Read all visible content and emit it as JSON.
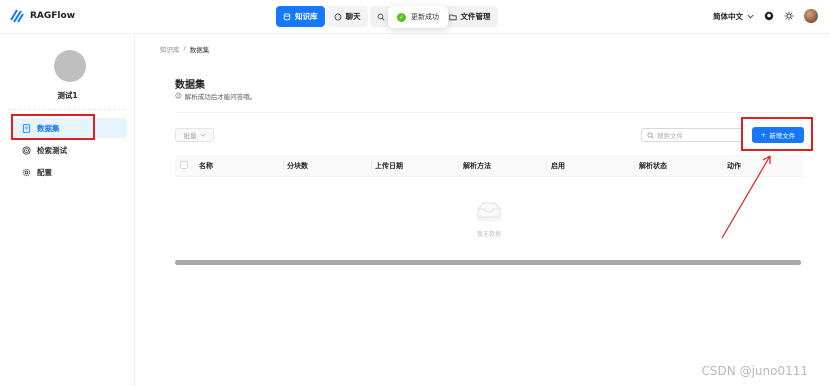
{
  "app": {
    "name": "RAGFlow"
  },
  "nav": {
    "items": [
      {
        "label": "知识库",
        "icon": "database-icon",
        "active": true
      },
      {
        "label": "聊天",
        "icon": "chat-icon",
        "active": false
      },
      {
        "label": "搜索",
        "icon": "search-icon",
        "active": false
      },
      {
        "label": "文件管理",
        "icon": "folder-icon",
        "active": false
      }
    ]
  },
  "toast": {
    "text": "更新成功",
    "icon": "check-circle-icon",
    "color": "#52c41a"
  },
  "header_right": {
    "language": "简体中文"
  },
  "sidebar": {
    "kb_name": "测试1",
    "items": [
      {
        "label": "数据集",
        "icon": "document-icon",
        "active": true
      },
      {
        "label": "检索测试",
        "icon": "target-icon",
        "active": false
      },
      {
        "label": "配置",
        "icon": "gear-icon",
        "active": false
      }
    ]
  },
  "breadcrumb": {
    "root": "知识库",
    "sep": "/",
    "current": "数据集"
  },
  "main": {
    "title": "数据集",
    "subtitle_emoji": "😉",
    "subtitle": "解析成功后才能问答哦。",
    "batch_label": "批量",
    "search_placeholder": "搜索文件",
    "new_button_label": "新增文件",
    "columns": [
      "名称",
      "分块数",
      "上传日期",
      "解析方法",
      "启用",
      "解析状态",
      "动作"
    ],
    "empty_text": "暂无数据"
  },
  "watermark": "CSDN @juno0111",
  "colors": {
    "accent": "#1677ff",
    "annotation_red": "#e02020"
  }
}
